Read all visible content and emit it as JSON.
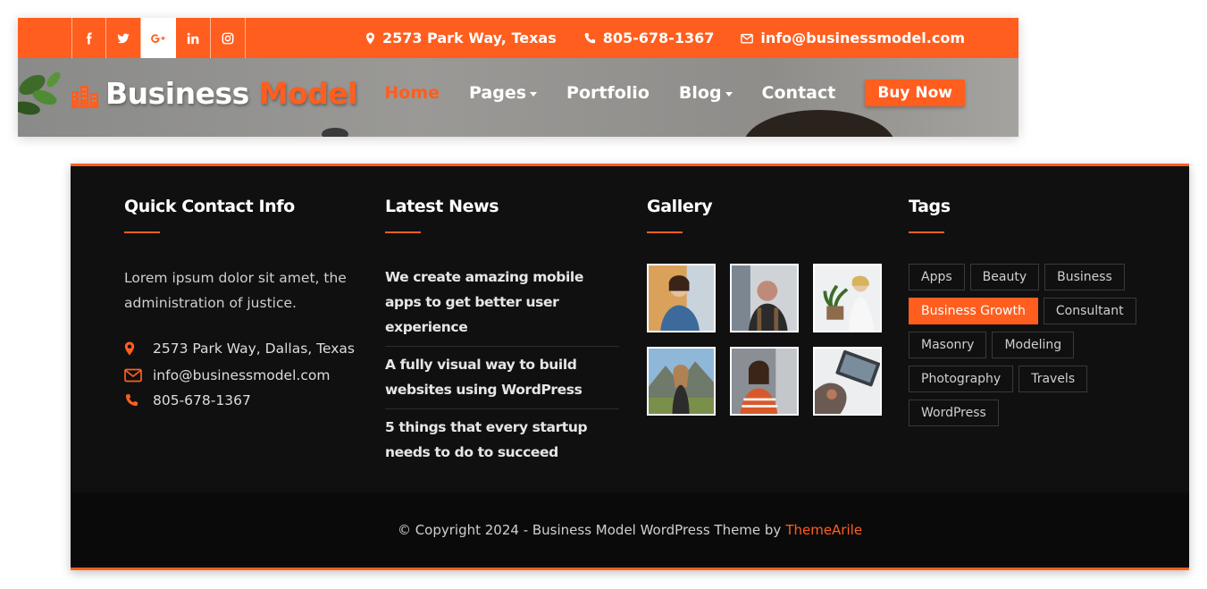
{
  "topbar": {
    "social": [
      {
        "icon": "facebook-icon",
        "active": false
      },
      {
        "icon": "twitter-icon",
        "active": false
      },
      {
        "icon": "google-plus-icon",
        "active": true
      },
      {
        "icon": "linkedin-icon",
        "active": false
      },
      {
        "icon": "instagram-icon",
        "active": false
      }
    ],
    "address": "2573 Park Way, Texas",
    "phone": "805-678-1367",
    "email": "info@businessmodel.com"
  },
  "brand": {
    "word1": "Business",
    "word2": "Model"
  },
  "nav": {
    "home": "Home",
    "pages": "Pages",
    "portfolio": "Portfolio",
    "blog": "Blog",
    "contact": "Contact",
    "buy": "Buy Now"
  },
  "footer": {
    "contact": {
      "title": "Quick Contact Info",
      "about": "Lorem ipsum dolor sit amet, the administration of justice.",
      "address": "2573 Park Way, Dallas, Texas",
      "email": "info@businessmodel.com",
      "phone": "805-678-1367"
    },
    "news": {
      "title": "Latest News",
      "items": [
        "We create amazing mobile apps to get better user experience",
        "A fully visual way to build websites using WordPress",
        "5 things that every startup needs to do to succeed"
      ]
    },
    "gallery": {
      "title": "Gallery"
    },
    "tags": {
      "title": "Tags",
      "items": [
        "Apps",
        "Beauty",
        "Business",
        "Business Growth",
        "Consultant",
        "Masonry",
        "Modeling",
        "Photography",
        "Travels",
        "WordPress"
      ],
      "active": "Business Growth"
    },
    "copyright": {
      "text": "© Copyright 2024 - Business Model WordPress Theme by",
      "link": "ThemeArile"
    }
  },
  "colors": {
    "accent": "#ff5e1f",
    "footer_bg": "#101010",
    "bottom_bar": "#0a0a0a"
  }
}
